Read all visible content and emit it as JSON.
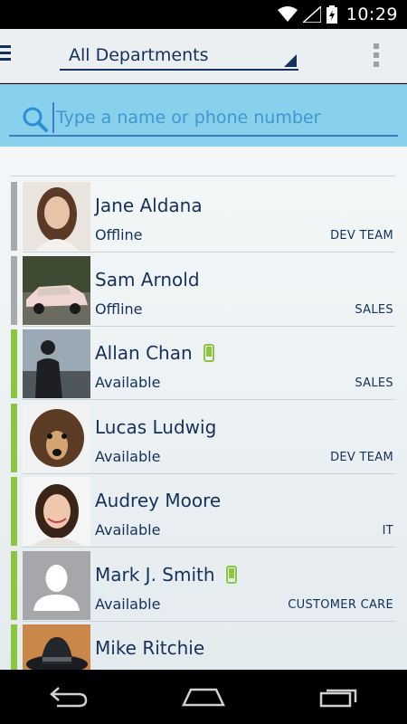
{
  "status_bar": {
    "time": "10:29"
  },
  "app_bar": {
    "department": "All Departments"
  },
  "search": {
    "placeholder": "Type a name or phone number"
  },
  "colors": {
    "available": "#8cc63f",
    "offline": "#a7a9ac",
    "accent": "#13315c",
    "search_bg": "#88d0ec"
  },
  "contacts": [
    {
      "name": "Jane Aldana",
      "status": "Offline",
      "department": "DEV TEAM",
      "mobile": false
    },
    {
      "name": "Sam Arnold",
      "status": "Offline",
      "department": "SALES",
      "mobile": false
    },
    {
      "name": "Allan Chan",
      "status": "Available",
      "department": "SALES",
      "mobile": true
    },
    {
      "name": "Lucas Ludwig",
      "status": "Available",
      "department": "DEV TEAM",
      "mobile": false
    },
    {
      "name": "Audrey Moore",
      "status": "Available",
      "department": "IT",
      "mobile": false
    },
    {
      "name": "Mark J. Smith",
      "status": "Available",
      "department": "CUSTOMER CARE",
      "mobile": true
    },
    {
      "name": "Mike Ritchie",
      "status": "",
      "department": "",
      "mobile": false
    }
  ]
}
